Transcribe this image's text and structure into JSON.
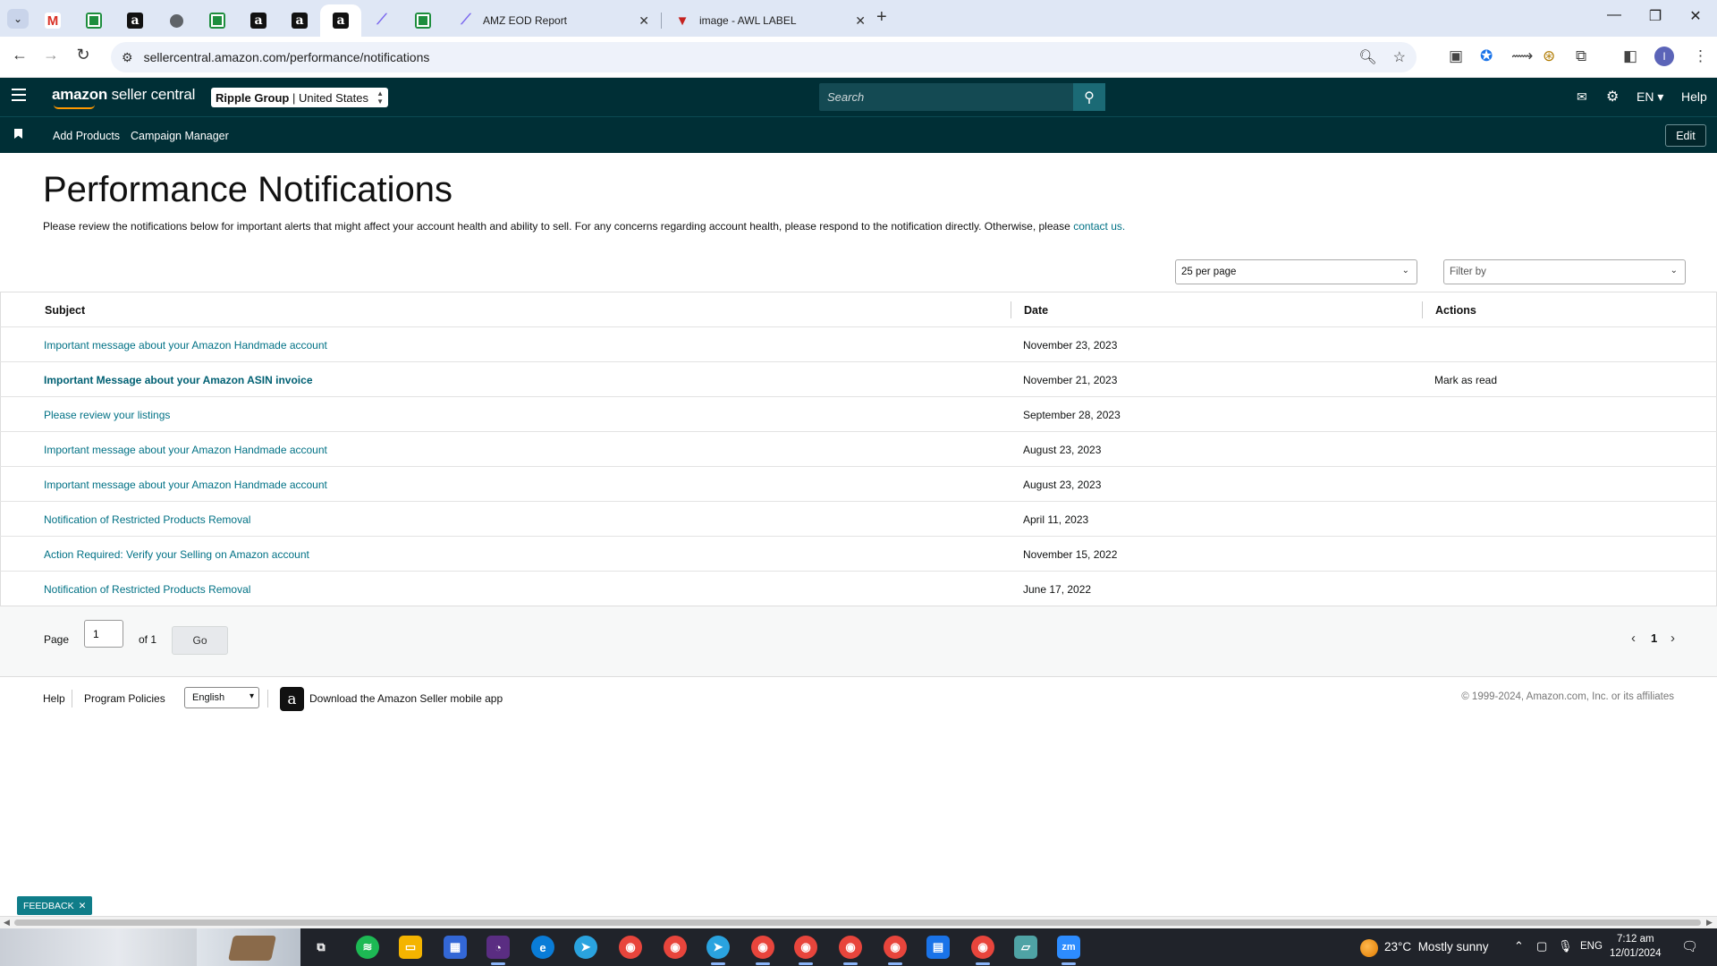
{
  "browser": {
    "pinned_tabs": [
      {
        "icon": "gmail-icon",
        "glyph": "M"
      },
      {
        "icon": "sheets-icon",
        "glyph": ""
      },
      {
        "icon": "amazon-icon",
        "glyph": "a"
      },
      {
        "icon": "globe-icon",
        "glyph": ""
      },
      {
        "icon": "sheets-icon",
        "glyph": ""
      },
      {
        "icon": "amazon-icon",
        "glyph": "a"
      },
      {
        "icon": "amazon-icon",
        "glyph": "a"
      },
      {
        "icon": "amazon-icon",
        "glyph": "a"
      },
      {
        "icon": "clickup-icon",
        "glyph": "⟋"
      },
      {
        "icon": "sheets-icon",
        "glyph": ""
      }
    ],
    "tabs": [
      {
        "title": "AMZ EOD Report",
        "icon": "clickup-icon"
      },
      {
        "title": "image - AWL LABEL",
        "icon": "awl-icon"
      }
    ],
    "url": "sellercentral.amazon.com/performance/notifications"
  },
  "header": {
    "logo_amazon": "amazon",
    "logo_rest": " seller central",
    "store_name": "Ripple Group",
    "store_market": "United States",
    "search_placeholder": "Search",
    "language": "EN",
    "help": "Help"
  },
  "subnav": {
    "links": [
      "Add Products",
      "Campaign Manager"
    ],
    "edit": "Edit"
  },
  "main": {
    "title": "Performance Notifications",
    "intro": "Please review the notifications below for important alerts that might affect your account health and ability to sell. For any concerns regarding account health, please respond to the notification directly. Otherwise, please ",
    "intro_link": "contact us.",
    "per_page": "25 per page",
    "filter_placeholder": "Filter by"
  },
  "table": {
    "columns": [
      "Subject",
      "Date",
      "Actions"
    ],
    "rows": [
      {
        "subject": "Important message about your Amazon Handmade account",
        "date": "November 23, 2023",
        "action": "",
        "unread": false
      },
      {
        "subject": "Important Message about your Amazon ASIN invoice",
        "date": "November 21, 2023",
        "action": "Mark as read",
        "unread": true
      },
      {
        "subject": "Please review your listings",
        "date": "September 28, 2023",
        "action": "",
        "unread": false
      },
      {
        "subject": "Important message about your Amazon Handmade account",
        "date": "August 23, 2023",
        "action": "",
        "unread": false
      },
      {
        "subject": "Important message about your Amazon Handmade account",
        "date": "August 23, 2023",
        "action": "",
        "unread": false
      },
      {
        "subject": "Notification of Restricted Products Removal",
        "date": "April 11, 2023",
        "action": "",
        "unread": false
      },
      {
        "subject": "Action Required: Verify your Selling on Amazon account",
        "date": "November 15, 2022",
        "action": "",
        "unread": false
      },
      {
        "subject": "Notification of Restricted Products Removal",
        "date": "June 17, 2022",
        "action": "",
        "unread": false
      }
    ]
  },
  "pager": {
    "label": "Page",
    "value": "1",
    "of": "of 1",
    "go": "Go",
    "current": "1"
  },
  "footer": {
    "help": "Help",
    "policies": "Program Policies",
    "language": "English",
    "app_text": "Download the Amazon Seller mobile app",
    "copyright": "© 1999-2024, Amazon.com, Inc. or its affiliates"
  },
  "feedback": "FEEDBACK",
  "taskbar": {
    "weather_temp": "23°C",
    "weather_desc": "Mostly sunny",
    "lang": "ENG",
    "time": "7:12 am",
    "date": "12/01/2024",
    "notifications": "1"
  },
  "colors": {
    "header_bg": "#002f36",
    "link": "#007185",
    "accent": "#ff9900"
  }
}
